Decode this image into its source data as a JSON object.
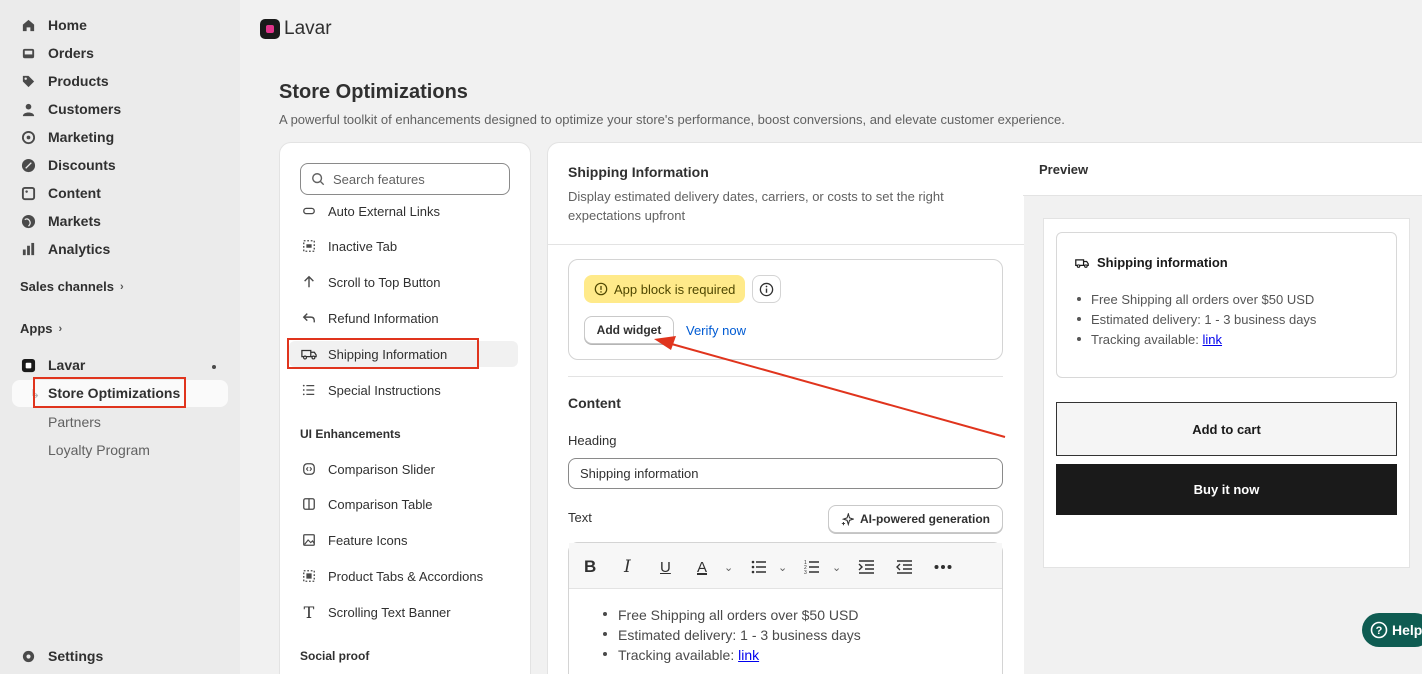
{
  "sidebar": {
    "nav": [
      {
        "label": "Home",
        "icon": "home-icon"
      },
      {
        "label": "Orders",
        "icon": "orders-icon"
      },
      {
        "label": "Products",
        "icon": "tag-icon"
      },
      {
        "label": "Customers",
        "icon": "person-icon"
      },
      {
        "label": "Marketing",
        "icon": "target-icon"
      },
      {
        "label": "Discounts",
        "icon": "discount-icon"
      },
      {
        "label": "Content",
        "icon": "content-icon"
      },
      {
        "label": "Markets",
        "icon": "globe-icon"
      },
      {
        "label": "Analytics",
        "icon": "bar-chart-icon"
      }
    ],
    "sales_channels": "Sales channels",
    "apps": "Apps",
    "app_name": "Lavar",
    "app_subitems": [
      "Store Optimizations",
      "Partners",
      "Loyalty Program"
    ],
    "settings": "Settings"
  },
  "topbar": {
    "app_name": "Lavar"
  },
  "page": {
    "title": "Store Optimizations",
    "subtitle": "A powerful toolkit of enhancements designed to optimize your store's performance, boost conversions, and elevate customer experience."
  },
  "features": {
    "search_placeholder": "Search features",
    "items": [
      "Auto External Links",
      "Inactive Tab",
      "Scroll to Top Button",
      "Refund Information",
      "Shipping Information",
      "Special Instructions"
    ],
    "group_ui": "UI Enhancements",
    "ui_items": [
      "Comparison Slider",
      "Comparison Table",
      "Feature Icons",
      "Product Tabs & Accordions",
      "Scrolling Text Banner"
    ],
    "group_social": "Social proof"
  },
  "editor": {
    "title": "Shipping Information",
    "description": "Display estimated delivery dates, carriers, or costs to set the right expectations upfront",
    "warning": "App block is required",
    "add_widget": "Add widget",
    "verify": "Verify now",
    "content_heading": "Content",
    "heading_label": "Heading",
    "heading_value": "Shipping information",
    "text_label": "Text",
    "ai_button": "AI-powered generation",
    "list": [
      "Free Shipping all orders over $50 USD",
      "Estimated delivery: 1 - 3 business days",
      "Tracking available: "
    ],
    "link_text": "link"
  },
  "preview": {
    "title": "Preview",
    "card_title": "Shipping information",
    "list": [
      "Free Shipping all orders over $50 USD",
      "Estimated delivery: 1 - 3 business days",
      "Tracking available: "
    ],
    "link_text": "link",
    "add_to_cart": "Add to cart",
    "buy_now": "Buy it now"
  },
  "help": "Help",
  "colors": {
    "highlight_box": "#e0341d",
    "warning_bg": "#ffea8a",
    "link": "#005bd3",
    "help_bg": "#0f5c52"
  }
}
